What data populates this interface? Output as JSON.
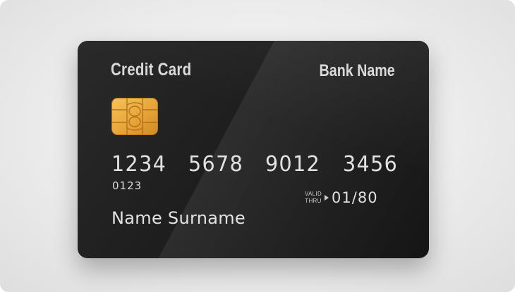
{
  "card": {
    "title": "Credit Card",
    "bank_name": "Bank Name",
    "number_groups": [
      "1234",
      "5678",
      "9012",
      "3456"
    ],
    "small_number": "0123",
    "valid_label_line1": "VALID",
    "valid_label_line2": "THRU",
    "expiry": "01/80",
    "holder_name": "Name Surname"
  },
  "colors": {
    "card_body": "#1f1f1f",
    "text": "#e2e2e2",
    "chip_gold": "#e9a83a",
    "background": "#ececec"
  },
  "icons": {
    "chip": "emv-chip-icon",
    "arrow": "triangle-right-icon"
  }
}
